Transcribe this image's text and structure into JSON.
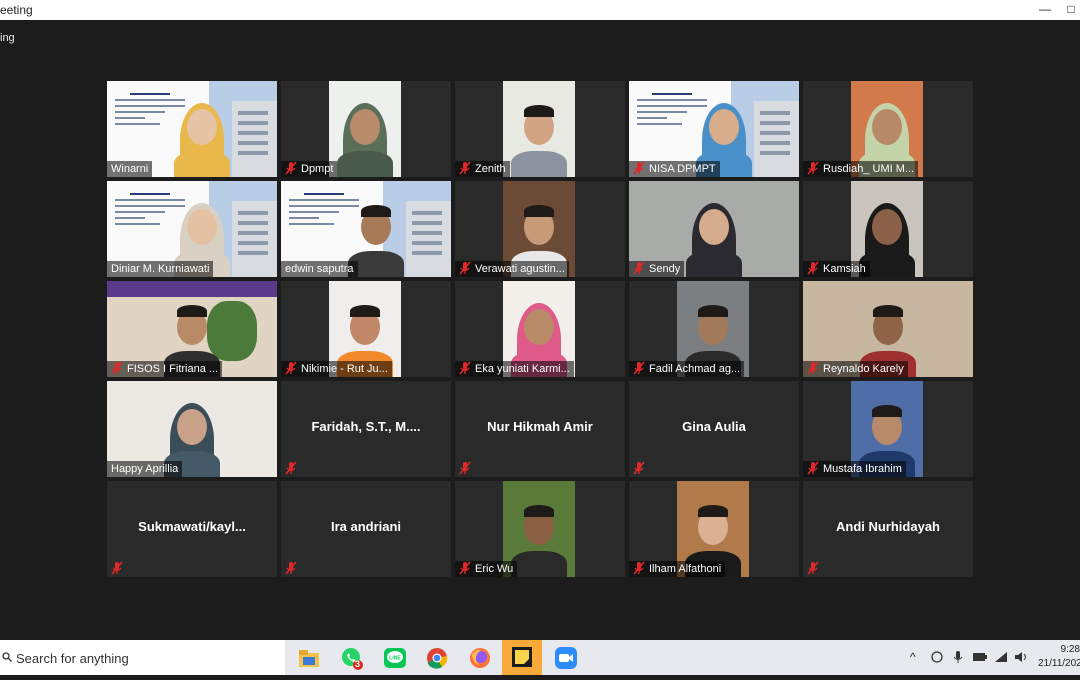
{
  "window": {
    "title": "eeting",
    "minimize_label": "—",
    "maximize_label": "□"
  },
  "meeting": {
    "subtitle": "ing"
  },
  "participants": [
    {
      "name": "Winarni",
      "video": true,
      "muted": false
    },
    {
      "name": "Dpmpt",
      "video": true,
      "muted": true
    },
    {
      "name": "Zenith",
      "video": true,
      "muted": true
    },
    {
      "name": "NISA DPMPT",
      "video": true,
      "muted": true
    },
    {
      "name": "Rusdiah_ UMI M...",
      "video": true,
      "muted": true
    },
    {
      "name": "Diniar M. Kurniawati",
      "video": true,
      "muted": false,
      "active": true
    },
    {
      "name": "edwin saputra",
      "video": true,
      "muted": false
    },
    {
      "name": "Verawati agustin...",
      "video": true,
      "muted": true
    },
    {
      "name": "Sendy",
      "video": true,
      "muted": true
    },
    {
      "name": "Kamsiah",
      "video": true,
      "muted": true
    },
    {
      "name": "FISOS I Fitriana ...",
      "video": true,
      "muted": true
    },
    {
      "name": "Nikimie - Rut Ju...",
      "video": true,
      "muted": true
    },
    {
      "name": "Eka yuniati Karmi...",
      "video": true,
      "muted": true
    },
    {
      "name": "Fadil Achmad ag...",
      "video": true,
      "muted": true
    },
    {
      "name": "Reynaldo Karely",
      "video": true,
      "muted": true
    },
    {
      "name": "Happy Aprillia",
      "video": true,
      "muted": false
    },
    {
      "name": "Faridah, S.T., M....",
      "video": false,
      "muted": true
    },
    {
      "name": "Nur Hikmah Amir",
      "video": false,
      "muted": true
    },
    {
      "name": "Gina Aulia",
      "video": false,
      "muted": true
    },
    {
      "name": "Mustafa Ibrahim",
      "video": true,
      "muted": true
    },
    {
      "name": "Sukmawati/kayl...",
      "video": false,
      "muted": true
    },
    {
      "name": "Ira andriani",
      "video": false,
      "muted": true
    },
    {
      "name": "Eric Wu",
      "video": true,
      "muted": true
    },
    {
      "name": "Ilham Alfathoni",
      "video": true,
      "muted": true
    },
    {
      "name": "Andi Nurhidayah",
      "video": false,
      "muted": true
    }
  ],
  "taskbar": {
    "search_placeholder": "Search for anything",
    "apps": [
      "file-explorer-icon",
      "whatsapp-icon",
      "line-icon",
      "chrome-icon",
      "firefox-icon",
      "sticky-notes-icon",
      "zoom-icon"
    ],
    "whatsapp_badge": "3",
    "time": "9:28",
    "date": "21/11/202"
  },
  "colors": {
    "background": "#1c1c1c",
    "tile": "#2a2a2a",
    "active_speaker_border": "#c6d940",
    "muted_red": "#e02828",
    "taskbar": "#e7e9ee"
  }
}
